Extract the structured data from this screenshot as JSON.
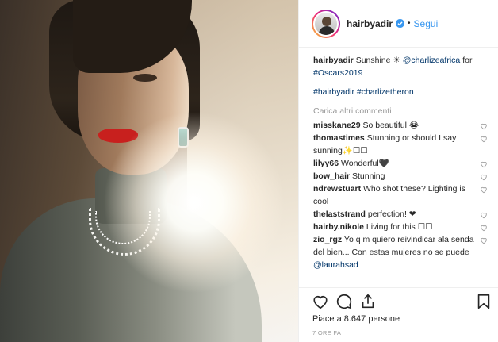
{
  "post": {
    "author": "hairbyadir",
    "follow_label": "Segui",
    "dot": "•",
    "caption": {
      "author": "hairbyadir",
      "text": "Sunshine ☀",
      "mention": "@charlizeafrica",
      "for": "for",
      "hashtag": "#Oscars2019"
    },
    "tags": [
      "#hairbyadir",
      "#charlizetheron"
    ],
    "load_more": "Carica altri commenti",
    "comments": [
      {
        "author": "misskane29",
        "text": "So beautiful 😭"
      },
      {
        "author": "thomastimes",
        "text": "Stunning or should I say sunning✨☐☐"
      },
      {
        "author": "lilyy66",
        "text": "Wonderful🖤"
      },
      {
        "author": "bow_hair",
        "text": "Stunning"
      },
      {
        "author": "ndrewstuart",
        "text": "Who shot these? Lighting is cool"
      },
      {
        "author": "thelaststrand",
        "text": "perfection! ❤"
      },
      {
        "author": "hairby.nikole",
        "text": "Living for this ☐☐"
      },
      {
        "author": "zio_rgz",
        "text": "Yo q m quiero reivindicar ala senda del bien... Con estas mujeres no se puede",
        "mention": "@laurahsad"
      }
    ],
    "likes": "Piace a 8.647 persone",
    "time": "7 ORE FA"
  },
  "icons": {
    "verified": "verified-badge-icon",
    "like": "heart-icon",
    "comment": "comment-icon",
    "share": "share-icon",
    "save": "bookmark-icon"
  },
  "colors": {
    "link": "#003569",
    "follow": "#3897f0",
    "muted": "#999999"
  }
}
